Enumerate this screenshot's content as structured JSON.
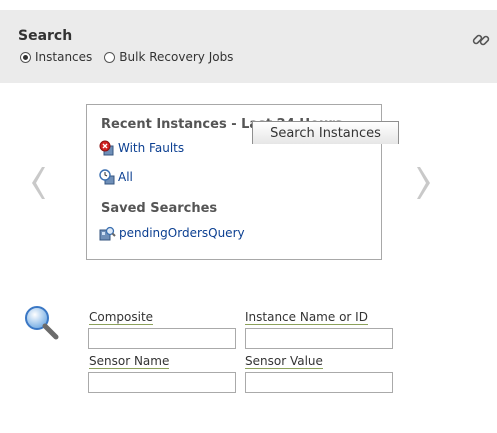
{
  "header": {
    "title": "Search",
    "radio_options": [
      {
        "label": "Instances",
        "checked": true
      },
      {
        "label": "Bulk Recovery Jobs",
        "checked": false
      }
    ],
    "link_icon": "chain-link-icon"
  },
  "carousel": {
    "prev_icon": "chevron-left-icon",
    "next_icon": "chevron-right-icon",
    "recent_heading": "Recent Instances - Last 24 Hours",
    "recent_links": [
      {
        "label": "With Faults",
        "icon": "error-instances-icon"
      },
      {
        "label": "All",
        "icon": "clock-instances-icon"
      }
    ],
    "saved_heading": "Saved Searches",
    "saved_links": [
      {
        "label": "pendingOrdersQuery",
        "icon": "saved-query-icon"
      }
    ]
  },
  "search_form": {
    "composite_label": "Composite",
    "composite_value": "",
    "instance_label": "Instance Name or ID",
    "instance_value": "",
    "sensor_name_label": "Sensor Name",
    "sensor_name_value": "",
    "sensor_value_label": "Sensor Value",
    "sensor_value_value": "",
    "submit_label": "Search Instances"
  },
  "colors": {
    "header_bg": "#ebebeb",
    "link_color": "#0b3f91",
    "label_underline": "#8ca15b"
  }
}
